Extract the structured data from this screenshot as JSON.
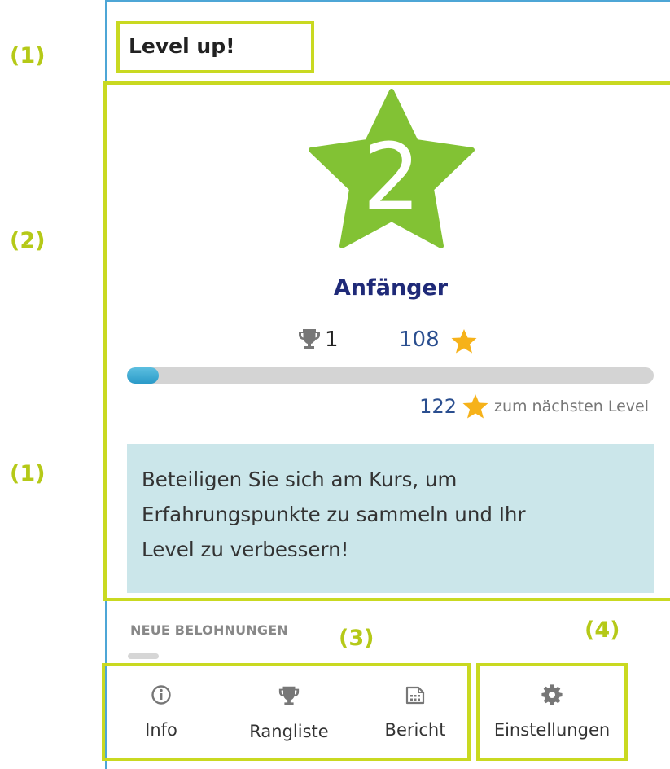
{
  "annotations": {
    "label_1": "(1)",
    "label_2": "(2)",
    "label_3": "(3)",
    "label_4": "(4)"
  },
  "block": {
    "title": "Level up!"
  },
  "level": {
    "number": "2",
    "name": "Anfänger",
    "badge_color": "#82c234",
    "trophy_count": "1",
    "points": "108",
    "progress_fraction": 0.06,
    "points_to_next": "122",
    "to_next_label": "zum nächsten Level"
  },
  "info_message": {
    "line1": "Beteiligen Sie sich am Kurs, um",
    "line2": "Erfahrungspunkte zu sammeln und Ihr",
    "line3": "Level zu verbessern!"
  },
  "rewards": {
    "heading": "NEUE BELOHNUNGEN"
  },
  "nav": {
    "info": {
      "label": "Info",
      "icon": "info-icon"
    },
    "leaderboard": {
      "label": "Rangliste",
      "icon": "trophy-icon"
    },
    "report": {
      "label": "Bericht",
      "icon": "report-icon"
    },
    "settings": {
      "label": "Einstellungen",
      "icon": "gear-icon"
    }
  },
  "colors": {
    "accent": "#c9d921",
    "progress": "#2a9ac8",
    "level_name": "#1f2a78",
    "info_bg": "#cbe6ea"
  }
}
